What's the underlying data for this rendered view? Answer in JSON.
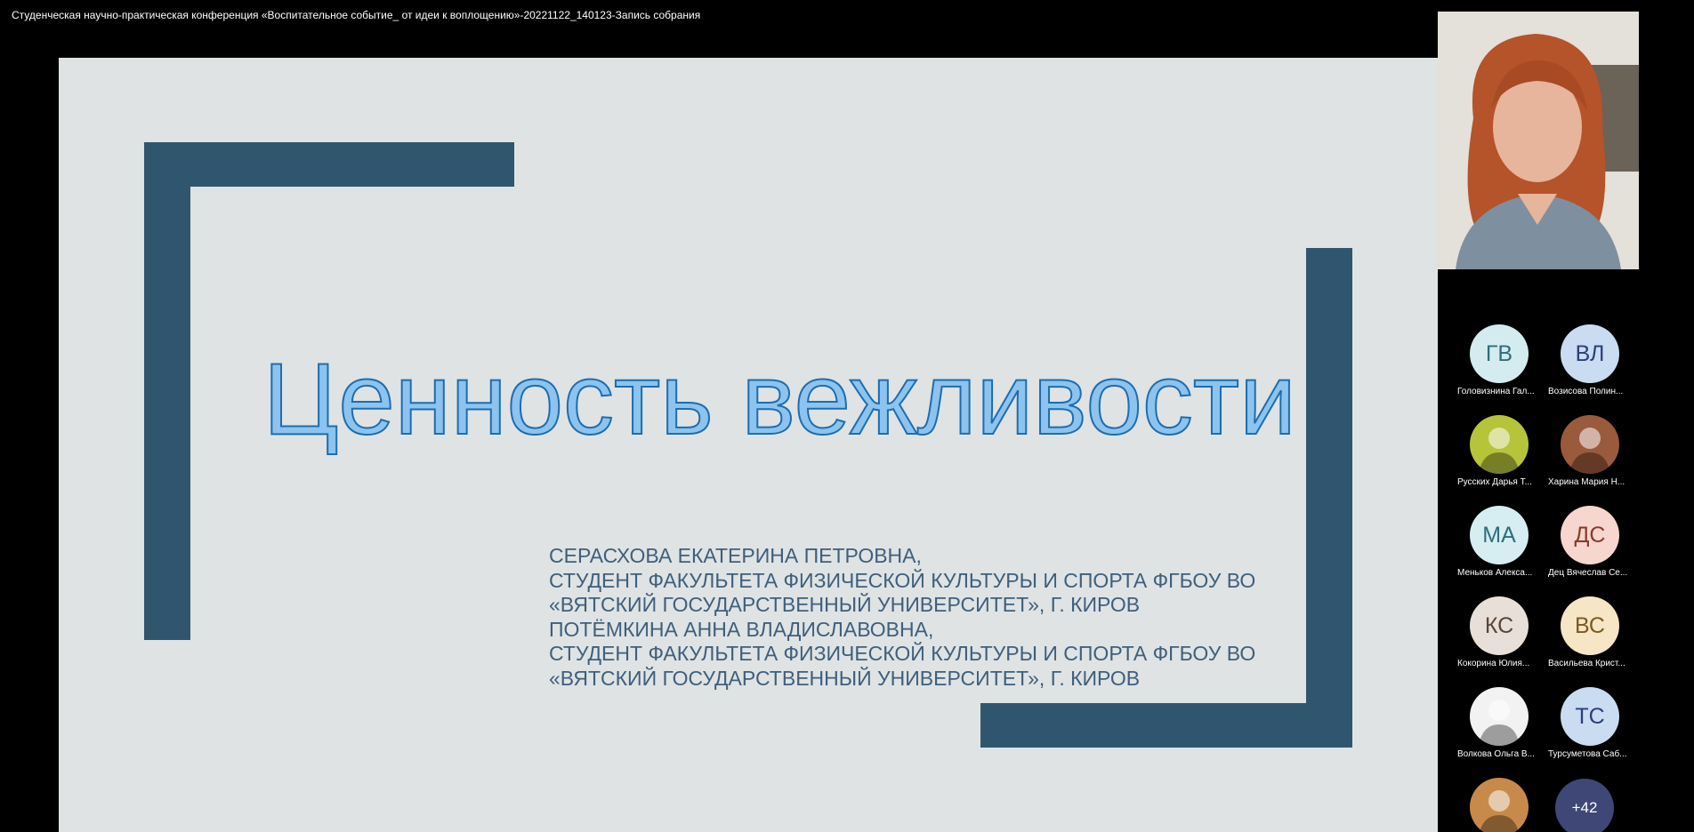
{
  "window": {
    "title": "Студенческая научно-практическая конференция «Воспитательное событие_ от идеи к воплощению»-20221122_140123-Запись собрания"
  },
  "slide": {
    "title": "Ценность вежливости",
    "authors": [
      "СЕРАСХОВА ЕКАТЕРИНА ПЕТРОВНА,",
      "СТУДЕНТ ФАКУЛЬТЕТА ФИЗИЧЕСКОЙ КУЛЬТУРЫ И СПОРТА ФГБОУ ВО",
      "«ВЯТСКИЙ ГОСУДАРСТВЕННЫЙ УНИВЕРСИТЕТ», Г. КИРОВ",
      "ПОТЁМКИНА АННА ВЛАДИСЛАВОВНА,",
      "СТУДЕНТ ФАКУЛЬТЕТА ФИЗИЧЕСКОЙ КУЛЬТУРЫ И СПОРТА ФГБОУ ВО",
      "«ВЯТСКИЙ ГОСУДАРСТВЕННЫЙ УНИВЕРСИТЕТ», Г. КИРОВ"
    ],
    "colors": {
      "background": "#dfe3e4",
      "frame": "#30566f",
      "title_fill": "#8cc4ef",
      "title_stroke": "#1c6db0",
      "authors": "#3f5f7c"
    }
  },
  "toolbar": {
    "fullscreen_icon": "collapse-fullscreen-icon"
  },
  "participants": [
    {
      "initials": "ГВ",
      "name": "Головизнина Гал...",
      "bg": "#d4ecf0",
      "fg": "#2f6e7a",
      "photo": false
    },
    {
      "initials": "ВЛ",
      "name": "Возисова Полин...",
      "bg": "#c9dcf2",
      "fg": "#2b3f7a",
      "photo": false
    },
    {
      "initials": "",
      "name": "Русских Дарья Т...",
      "bg": "#b6c43a",
      "fg": "#ffffff",
      "photo": true
    },
    {
      "initials": "",
      "name": "Харина Мария Н...",
      "bg": "#9a5a3c",
      "fg": "#ffffff",
      "photo": true
    },
    {
      "initials": "МА",
      "name": "Меньков Алекса...",
      "bg": "#d6eef1",
      "fg": "#2f6e7a",
      "photo": false
    },
    {
      "initials": "ДС",
      "name": "Дец Вячеслав Се...",
      "bg": "#f6d6cf",
      "fg": "#8a3a2a",
      "photo": false
    },
    {
      "initials": "КС",
      "name": "Кокорина Юлия...",
      "bg": "#e8e0d8",
      "fg": "#5a4538",
      "photo": false
    },
    {
      "initials": "ВС",
      "name": "Васильева Крист...",
      "bg": "#f6e6c6",
      "fg": "#7a5a20",
      "photo": false
    },
    {
      "initials": "",
      "name": "Волкова Ольга В...",
      "bg": "#f2f2f2",
      "fg": "#333333",
      "photo": true
    },
    {
      "initials": "ТС",
      "name": "Турсуметова Саб...",
      "bg": "#c9dcf2",
      "fg": "#2b3f7a",
      "photo": false
    },
    {
      "initials": "",
      "name": "",
      "bg": "#c88a4a",
      "fg": "#ffffff",
      "photo": true
    }
  ],
  "more_participants": "+42"
}
